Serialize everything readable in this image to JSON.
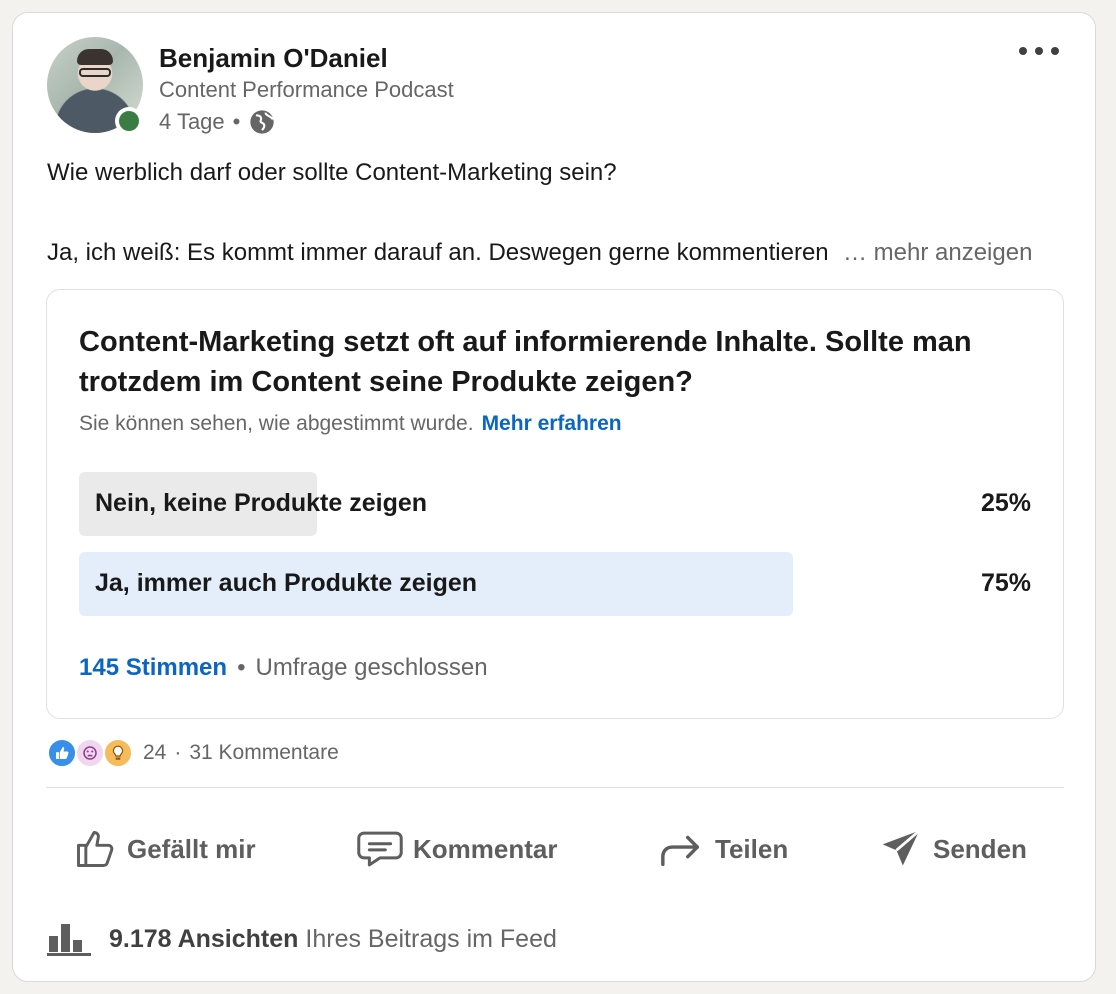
{
  "post": {
    "author_name": "Benjamin O'Daniel",
    "author_subtitle": "Content Performance Podcast",
    "timestamp": "4 Tage",
    "separator": "•",
    "visibility_icon": "globe-icon",
    "more_icon": "ellipsis-icon",
    "text_line1": "Wie werblich darf oder sollte Content-Marketing sein?",
    "text_line2": "Ja, ich weiß: Es kommt immer darauf an. Deswegen gerne kommentieren",
    "more_label": "… mehr anzeigen"
  },
  "poll": {
    "question": "Content-Marketing setzt oft auf informierende Inhalte. Sollte man trotzdem im Content seine Produkte zeigen?",
    "visibility_note": "Sie können sehen, wie abgestimmt wurde.",
    "learn_more": "Mehr erfahren",
    "options": [
      {
        "label": "Nein, keine Produkte zeigen",
        "percent_label": "25%",
        "percent": 25,
        "fill_color": "#eaeaea"
      },
      {
        "label": "Ja, immer auch Produkte zeigen",
        "percent_label": "75%",
        "percent": 75,
        "fill_color": "#e3eefa"
      }
    ],
    "votes": "145 Stimmen",
    "separator": "•",
    "status": "Umfrage geschlossen"
  },
  "social": {
    "reaction_icons": [
      "like-icon",
      "curious-icon",
      "insightful-icon"
    ],
    "reaction_count": "24",
    "separator": "·",
    "comments": "31 Kommentare"
  },
  "actions": {
    "like": "Gefällt mir",
    "comment": "Kommentar",
    "share": "Teilen",
    "send": "Senden"
  },
  "footer": {
    "impressions_count": "9.178 Ansichten",
    "impressions_suffix": "Ihres Beitrags im Feed"
  },
  "colors": {
    "link_blue": "#0a66c2",
    "online_green": "#3a7d44"
  }
}
